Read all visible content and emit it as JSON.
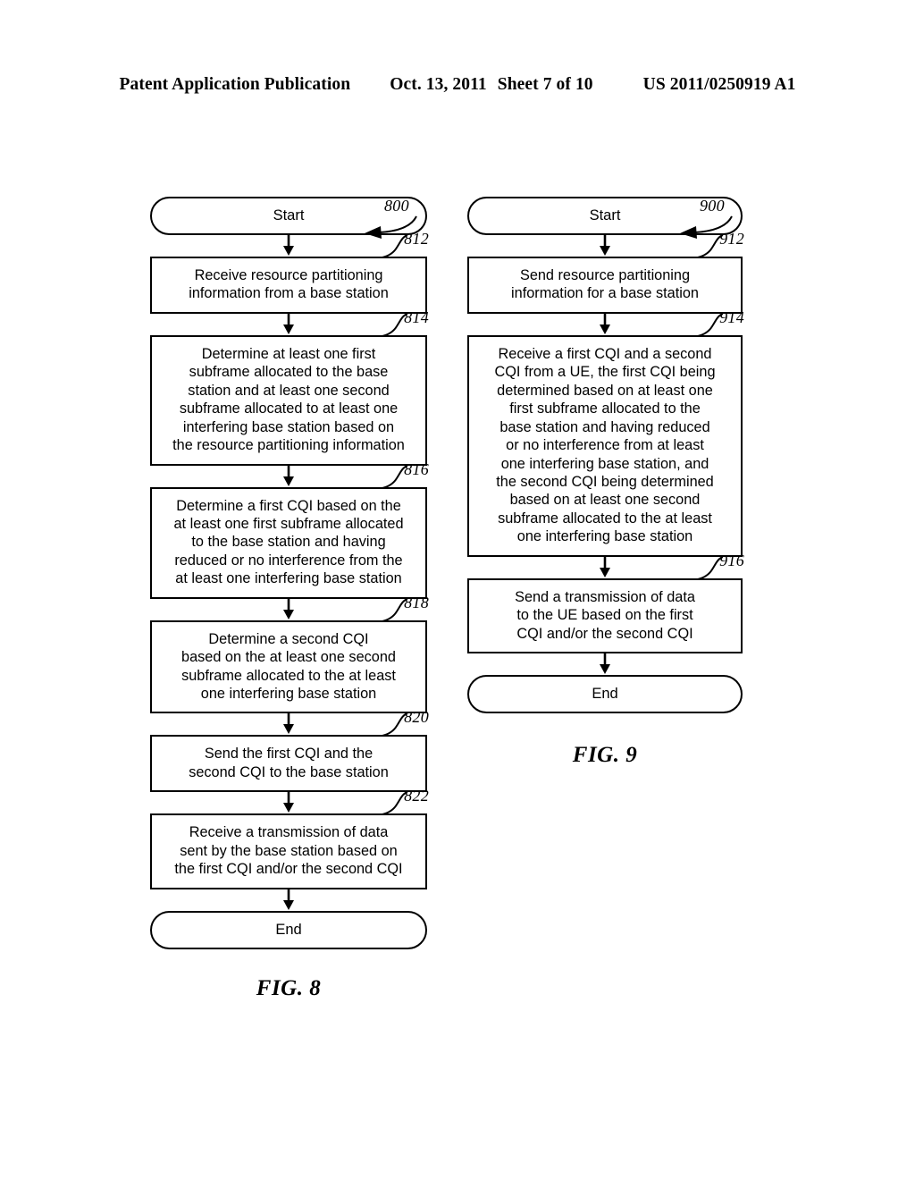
{
  "header": {
    "publication": "Patent Application Publication",
    "date": "Oct. 13, 2011",
    "sheet": "Sheet 7 of 10",
    "doc_number": "US 2011/0250919 A1"
  },
  "figures": [
    {
      "id": "800",
      "ref_number": "800",
      "caption": "FIG. 8",
      "start_label": "Start",
      "end_label": "End",
      "steps": [
        {
          "ref": "812",
          "text": "Receive resource partitioning\ninformation from a base station"
        },
        {
          "ref": "814",
          "text": "Determine at least one first\nsubframe allocated to the base\nstation and at least one second\nsubframe allocated to at least one\ninterfering base station based on\nthe resource partitioning information"
        },
        {
          "ref": "816",
          "text": "Determine a first CQI based on the\nat least one first subframe allocated\nto the base station and having\nreduced or no interference from the\nat least one interfering base station"
        },
        {
          "ref": "818",
          "text": "Determine a second CQI\nbased on the at least one second\nsubframe allocated to the at least\none interfering base station"
        },
        {
          "ref": "820",
          "text": "Send the first CQI and the\nsecond CQI to the base station"
        },
        {
          "ref": "822",
          "text": "Receive a transmission of data\nsent by the base station based on\nthe first CQI and/or the second CQI"
        }
      ]
    },
    {
      "id": "900",
      "ref_number": "900",
      "caption": "FIG. 9",
      "start_label": "Start",
      "end_label": "End",
      "steps": [
        {
          "ref": "912",
          "text": "Send resource partitioning\ninformation for a base station"
        },
        {
          "ref": "914",
          "text": "Receive a first CQI and a second\nCQI from a UE, the first CQI being\ndetermined based on at least one\nfirst subframe allocated to the\nbase station and having reduced\nor no interference from at least\none interfering base station, and\nthe second CQI being determined\nbased on at least one second\nsubframe allocated to the at least\none interfering base station"
        },
        {
          "ref": "916",
          "text": "Send a transmission of data\nto the UE based on the first\nCQI and/or the second CQI"
        }
      ]
    }
  ]
}
